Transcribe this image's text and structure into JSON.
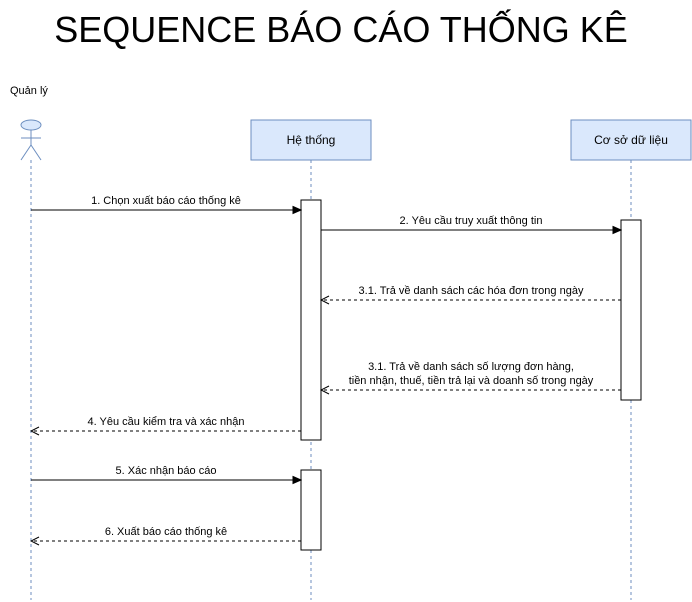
{
  "title": "SEQUENCE BÁO CÁO THỐNG KÊ",
  "colors": {
    "box_fill": "#dae8fc",
    "box_stroke": "#6c8ebf",
    "line": "#000000",
    "lifeline": "#6c8ebf",
    "actor_fill": "#dae8fc"
  },
  "participants": [
    {
      "id": "actor",
      "label": "Quản lý",
      "kind": "actor",
      "icon": "stick-figure-icon"
    },
    {
      "id": "system",
      "label": "Hệ thống",
      "kind": "box"
    },
    {
      "id": "db",
      "label": "Cơ sở dữ liệu",
      "kind": "box"
    }
  ],
  "messages": [
    {
      "from": "actor",
      "to": "system",
      "style": "sync",
      "lines": [
        "1. Chọn xuất báo cáo thống kê"
      ]
    },
    {
      "from": "system",
      "to": "db",
      "style": "sync",
      "lines": [
        "2. Yêu cầu truy xuất thông tin"
      ]
    },
    {
      "from": "db",
      "to": "system",
      "style": "return",
      "lines": [
        "3.1. Trả về danh sách các hóa đơn trong ngày"
      ]
    },
    {
      "from": "db",
      "to": "system",
      "style": "return",
      "lines": [
        "3.1. Trả về danh sách số lượng đơn hàng,",
        "tiền nhận, thuế, tiền trả lại và doanh số trong ngày"
      ]
    },
    {
      "from": "system",
      "to": "actor",
      "style": "return",
      "lines": [
        "4. Yêu cầu kiểm tra và xác nhận"
      ]
    },
    {
      "from": "actor",
      "to": "system",
      "style": "sync",
      "lines": [
        "5. Xác nhận báo cáo"
      ]
    },
    {
      "from": "system",
      "to": "actor",
      "style": "return",
      "lines": [
        "6. Xuất báo cáo thống kê"
      ]
    }
  ]
}
